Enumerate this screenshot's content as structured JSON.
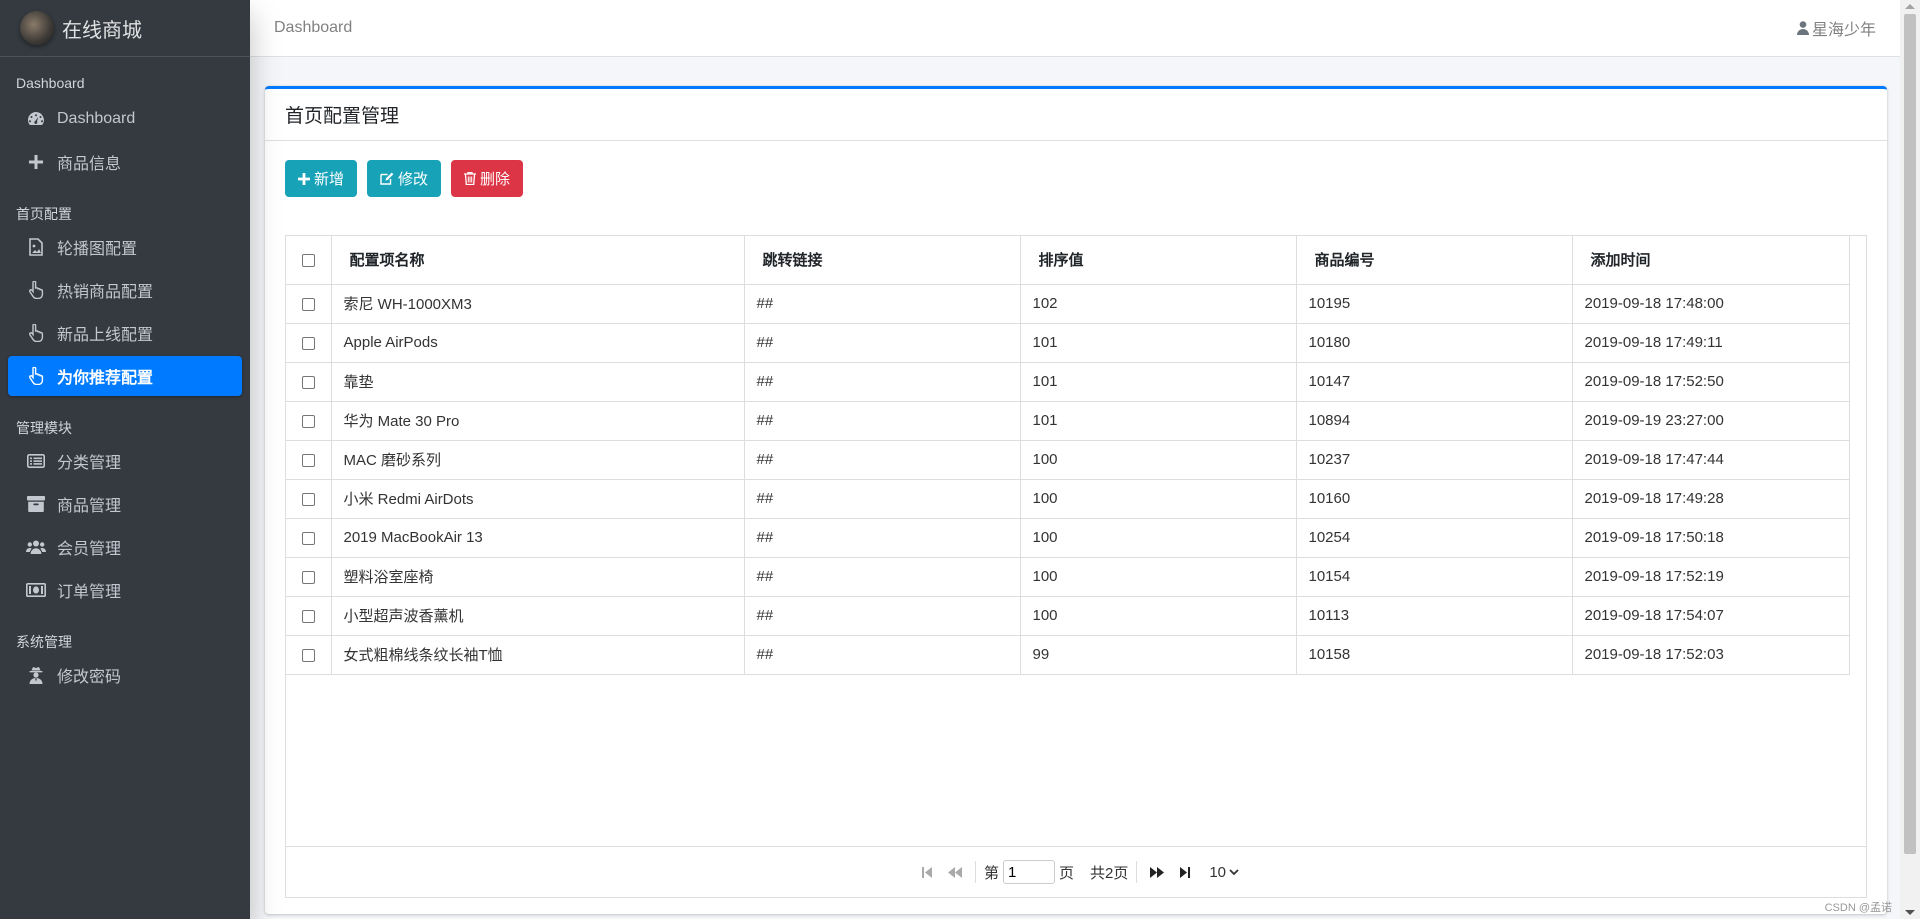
{
  "brand": {
    "title": "在线商城"
  },
  "sidebar": {
    "groups": [
      {
        "header": "Dashboard",
        "items": [
          {
            "label": "Dashboard",
            "icon": "dashboard-icon"
          },
          {
            "label": "商品信息",
            "icon": "plus-icon"
          }
        ]
      },
      {
        "header": "首页配置",
        "items": [
          {
            "label": "轮播图配置",
            "icon": "image-icon"
          },
          {
            "label": "热销商品配置",
            "icon": "hand-pointer-icon"
          },
          {
            "label": "新品上线配置",
            "icon": "hand-pointer-icon"
          },
          {
            "label": "为你推荐配置",
            "icon": "hand-pointer-icon",
            "active": true
          }
        ]
      },
      {
        "header": "管理模块",
        "items": [
          {
            "label": "分类管理",
            "icon": "list-icon"
          },
          {
            "label": "商品管理",
            "icon": "archive-icon"
          },
          {
            "label": "会员管理",
            "icon": "users-icon"
          },
          {
            "label": "订单管理",
            "icon": "money-icon"
          }
        ]
      },
      {
        "header": "系统管理",
        "items": [
          {
            "label": "修改密码",
            "icon": "user-secret-icon"
          }
        ]
      }
    ]
  },
  "topbar": {
    "breadcrumb": "Dashboard",
    "user": "星海少年"
  },
  "card": {
    "title": "首页配置管理",
    "buttons": {
      "add": "新增",
      "edit": "修改",
      "delete": "删除"
    }
  },
  "table": {
    "columns": [
      "配置项名称",
      "跳转链接",
      "排序值",
      "商品编号",
      "添加时间"
    ],
    "rows": [
      [
        "索尼 WH-1000XM3",
        "##",
        "102",
        "10195",
        "2019-09-18 17:48:00"
      ],
      [
        "Apple AirPods",
        "##",
        "101",
        "10180",
        "2019-09-18 17:49:11"
      ],
      [
        "靠垫",
        "##",
        "101",
        "10147",
        "2019-09-18 17:52:50"
      ],
      [
        "华为 Mate 30 Pro",
        "##",
        "101",
        "10894",
        "2019-09-19 23:27:00"
      ],
      [
        "MAC 磨砂系列",
        "##",
        "100",
        "10237",
        "2019-09-18 17:47:44"
      ],
      [
        "小米 Redmi AirDots",
        "##",
        "100",
        "10160",
        "2019-09-18 17:49:28"
      ],
      [
        "2019 MacBookAir 13",
        "##",
        "100",
        "10254",
        "2019-09-18 17:50:18"
      ],
      [
        "塑料浴室座椅",
        "##",
        "100",
        "10154",
        "2019-09-18 17:52:19"
      ],
      [
        "小型超声波香薰机",
        "##",
        "100",
        "10113",
        "2019-09-18 17:54:07"
      ],
      [
        "女式粗棉线条纹长袖T恤",
        "##",
        "99",
        "10158",
        "2019-09-18 17:52:03"
      ]
    ]
  },
  "pager": {
    "page_prefix": "第",
    "page_value": "1",
    "page_suffix": "页",
    "total": "共2页",
    "page_size": "10"
  },
  "watermark": "CSDN @孟诺",
  "colors": {
    "primary": "#007bff",
    "info": "#17a2b8",
    "danger": "#dc3545",
    "sidebar": "#343a40"
  }
}
